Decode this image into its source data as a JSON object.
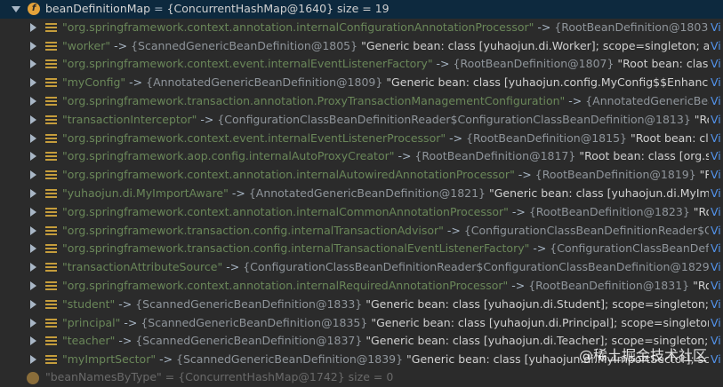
{
  "root": {
    "name": "beanDefinitionMap",
    "value": "{ConcurrentHashMap@1640}",
    "size_label": "size = 19"
  },
  "view_link": "Vi",
  "entries": [
    {
      "key": "\"org.springframework.context.annotation.internalConfigurationAnnotationProcessor\"",
      "type": "{RootBeanDefinition@1803}",
      "value": "\"Root b..."
    },
    {
      "key": "\"worker\"",
      "type": "{ScannedGenericBeanDefinition@1805}",
      "value": "\"Generic bean: class [yuhaojun.di.Worker]; scope=singleton; abstract=fa..."
    },
    {
      "key": "\"org.springframework.context.event.internalEventListenerFactory\"",
      "type": "{RootBeanDefinition@1807}",
      "value": "\"Root bean: class [org.spring..."
    },
    {
      "key": "\"myConfig\"",
      "type": "{AnnotatedGenericBeanDefinition@1809}",
      "value": "\"Generic bean: class [yuhaojun.config.MyConfig$$EnhancerBySpring..."
    },
    {
      "key": "\"org.springframework.transaction.annotation.ProxyTransactionManagementConfiguration\"",
      "type": "{AnnotatedGenericBeanDefinit...",
      "value": ""
    },
    {
      "key": "\"transactionInterceptor\"",
      "type": "{ConfigurationClassBeanDefinitionReader$ConfigurationClassBeanDefinition@1813}",
      "value": "\"Root bean:..."
    },
    {
      "key": "\"org.springframework.context.event.internalEventListenerProcessor\"",
      "type": "{RootBeanDefinition@1815}",
      "value": "\"Root bean: class [org.sp..."
    },
    {
      "key": "\"org.springframework.aop.config.internalAutoProxyCreator\"",
      "type": "{RootBeanDefinition@1817}",
      "value": "\"Root bean: class [org.springfra..."
    },
    {
      "key": "\"org.springframework.context.annotation.internalAutowiredAnnotationProcessor\"",
      "type": "{RootBeanDefinition@1819}",
      "value": "\"Root bea..."
    },
    {
      "key": "\"yuhaojun.di.MyImportAware\"",
      "type": "{AnnotatedGenericBeanDefinition@1821}",
      "value": "\"Generic bean: class [yuhaojun.di.MyImportAware..."
    },
    {
      "key": "\"org.springframework.context.annotation.internalCommonAnnotationProcessor\"",
      "type": "{RootBeanDefinition@1823}",
      "value": "\"Root bean:..."
    },
    {
      "key": "\"org.springframework.transaction.config.internalTransactionAdvisor\"",
      "type": "{ConfigurationClassBeanDefinitionReader$Configura...",
      "value": ""
    },
    {
      "key": "\"org.springframework.transaction.config.internalTransactionalEventListenerFactory\"",
      "type": "{ConfigurationClassBeanDefinitionRea...",
      "value": ""
    },
    {
      "key": "\"transactionAttributeSource\"",
      "type": "{ConfigurationClassBeanDefinitionReader$ConfigurationClassBeanDefinition@1829}",
      "value": "\"Root be..."
    },
    {
      "key": "\"org.springframework.context.annotation.internalRequiredAnnotationProcessor\"",
      "type": "{RootBeanDefinition@1831}",
      "value": "\"Root bean:..."
    },
    {
      "key": "\"student\"",
      "type": "{ScannedGenericBeanDefinition@1833}",
      "value": "\"Generic bean: class [yuhaojun.di.Student]; scope=singleton; abstract=f..."
    },
    {
      "key": "\"principal\"",
      "type": "{ScannedGenericBeanDefinition@1835}",
      "value": "\"Generic bean: class [yuhaojun.di.Principal]; scope=singleton; abstract=..."
    },
    {
      "key": "\"teacher\"",
      "type": "{ScannedGenericBeanDefinition@1837}",
      "value": "\"Generic bean: class [yuhaojun.di.Teacher]; scope=singleton; abstract=f..."
    },
    {
      "key": "\"myImprtSector\"",
      "type": "{ScannedGenericBeanDefinition@1839}",
      "value": "\"Generic bean: class [yuhaojun.di.MyImportSector]; scope=singlet..."
    }
  ],
  "next_row_text": "\"beanNamesByType\" = {ConcurrentHashMap@1742}  size = 0",
  "watermark": "@稀土掘金技术社区"
}
